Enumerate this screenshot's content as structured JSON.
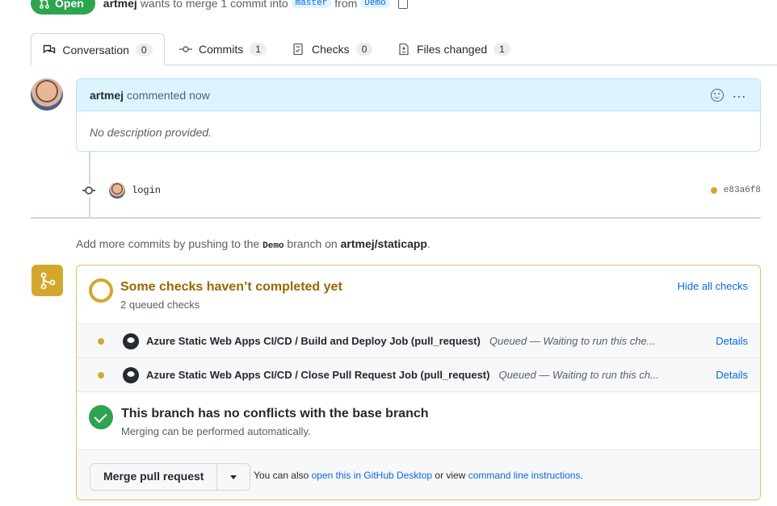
{
  "header": {
    "status": "Open",
    "author": "artmej",
    "merge_text": "wants to merge 1 commit into",
    "base_branch": "master",
    "from_text": "from",
    "head_branch": "Demo"
  },
  "tabs": [
    {
      "label": "Conversation",
      "count": "0",
      "icon": "conversation-icon",
      "active": true
    },
    {
      "label": "Commits",
      "count": "1",
      "icon": "commit-icon"
    },
    {
      "label": "Checks",
      "count": "0",
      "icon": "checklist-icon"
    },
    {
      "label": "Files changed",
      "count": "1",
      "icon": "file-diff-icon"
    }
  ],
  "comment": {
    "author": "artmej",
    "action": "commented now",
    "body": "No description provided."
  },
  "commit": {
    "message": "login",
    "sha": "e83a6f8",
    "status_color": "#d4a72c"
  },
  "hint": {
    "prefix": "Add more commits by pushing to the",
    "branch": "Demo",
    "middle": "branch on",
    "repo": "artmej/staticapp",
    "suffix": "."
  },
  "checks": {
    "title": "Some checks haven’t completed yet",
    "subtitle": "2 queued checks",
    "hide_label": "Hide all checks",
    "items": [
      {
        "name": "Azure Static Web Apps CI/CD / Build and Deploy Job (pull_request)",
        "status": "Queued — Waiting to run this che...",
        "details": "Details"
      },
      {
        "name": "Azure Static Web Apps CI/CD / Close Pull Request Job (pull_request)",
        "status": "Queued — Waiting to run this ch...",
        "details": "Details"
      }
    ]
  },
  "conflicts": {
    "title": "This branch has no conflicts with the base branch",
    "subtitle": "Merging can be performed automatically."
  },
  "merge": {
    "button_label": "Merge pull request",
    "text_prefix": "You can also",
    "desktop_link": "open this in GitHub Desktop",
    "text_middle": "or view",
    "cli_link": "command line instructions",
    "text_suffix": "."
  },
  "colors": {
    "open_green": "#2da44e",
    "pending_yellow": "#d4a72c",
    "link_blue": "#0969da"
  }
}
